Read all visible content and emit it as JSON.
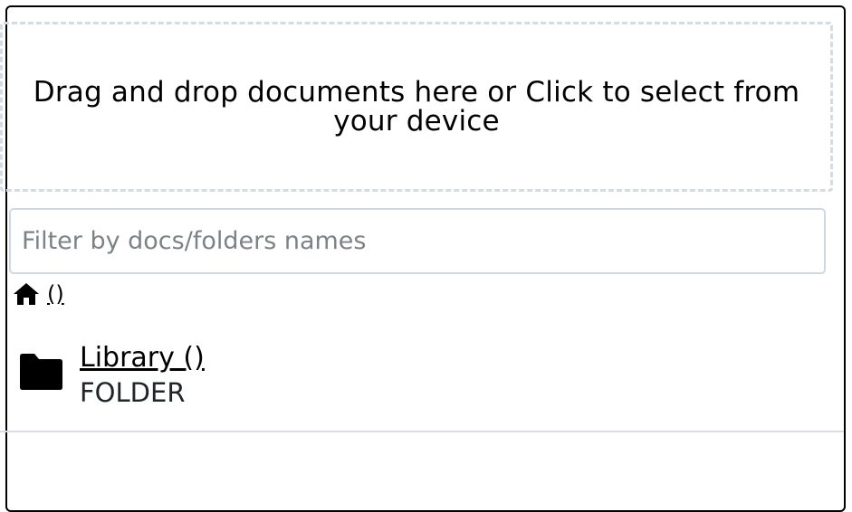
{
  "dropzone": {
    "text": "Drag and drop documents here or Click to select from your device"
  },
  "filter": {
    "placeholder": "Filter by docs/folders names",
    "value": ""
  },
  "breadcrumb": {
    "home_icon": "home-icon",
    "label": " ()"
  },
  "folders": [
    {
      "icon": "folder-icon",
      "name": "Library ()",
      "type": "FOLDER"
    }
  ],
  "colors": {
    "dropzone_border": "#d3dbe3",
    "input_border": "#ced9e3",
    "divider": "#d9dee3"
  }
}
